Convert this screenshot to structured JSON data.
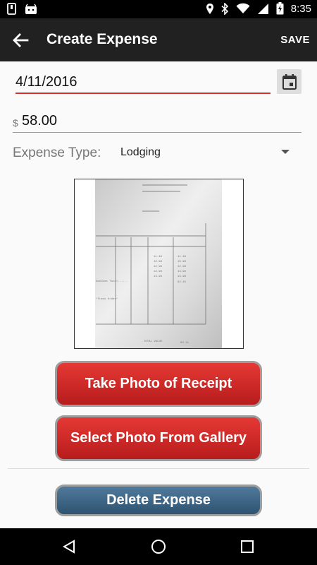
{
  "status_bar": {
    "time": "8:35",
    "icons": [
      "phone-notification-icon",
      "android-icon",
      "location-icon",
      "bluetooth-icon",
      "wifi-icon",
      "signal-icon",
      "battery-charging-icon"
    ]
  },
  "app_bar": {
    "title": "Create Expense",
    "save_label": "SAVE",
    "back_icon": "arrow-back-icon"
  },
  "form": {
    "date": "4/11/2016",
    "calendar_icon": "calendar-icon",
    "currency_symbol": "$",
    "amount": "58.00",
    "expense_type_label": "Expense Type:",
    "expense_type_value": "Lodging"
  },
  "receipt": {
    "image": "receipt-photo"
  },
  "buttons": {
    "take_photo": "Take Photo of Receipt",
    "select_gallery": "Select Photo From Gallery",
    "delete": "Delete Expense"
  },
  "colors": {
    "accent_red": "#d32f2f",
    "button_red": "#c62828",
    "button_blue": "#3b6585",
    "app_bar": "#212121"
  }
}
